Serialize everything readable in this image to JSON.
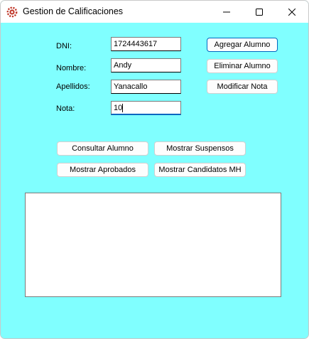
{
  "window": {
    "title": "Gestion de Calificaciones",
    "icon": "app-gear-icon",
    "controls": [
      "minimize-icon",
      "maximize-icon",
      "close-icon"
    ]
  },
  "form": {
    "dni_label": "DNI:",
    "dni_value": "1724443617",
    "nombre_label": "Nombre:",
    "nombre_value": "Andy",
    "apellidos_label": "Apellidos:",
    "apellidos_value": "Yanacallo",
    "nota_label": "Nota:",
    "nota_value": "10"
  },
  "actions": {
    "agregar": "Agregar Alumno",
    "eliminar": "Eliminar Alumno",
    "modificar": "Modificar Nota"
  },
  "queries": {
    "consultar": "Consultar Alumno",
    "suspensos": "Mostrar Suspensos",
    "aprobados": "Mostrar Aprobados",
    "candidatos": "Mostrar Candidatos MH"
  },
  "results": {
    "items": []
  },
  "colors": {
    "form_background": "#80ffff",
    "focus_accent": "#0067c0",
    "app_icon": "#c0392b"
  }
}
